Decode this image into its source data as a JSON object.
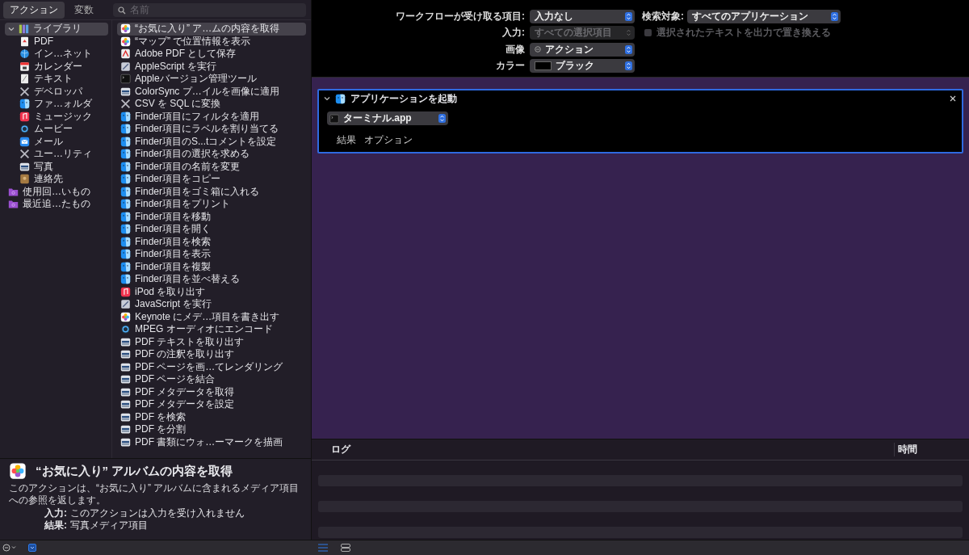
{
  "toolbar": {
    "tabs": [
      {
        "label": "アクション",
        "selected": true
      },
      {
        "label": "変数",
        "selected": false
      }
    ],
    "search": {
      "placeholder": "名前"
    }
  },
  "library": [
    {
      "label": "ライブラリ",
      "kind": "library",
      "selected": true,
      "expanded": true,
      "children": [
        {
          "label": "PDF",
          "kind": "pdf",
          "selected": false
        },
        {
          "label": "イン…ネット",
          "kind": "globe",
          "selected": false
        },
        {
          "label": "カレンダー",
          "kind": "calendar",
          "selected": false
        },
        {
          "label": "テキスト",
          "kind": "text",
          "selected": false
        },
        {
          "label": "デベロッパ",
          "kind": "tools",
          "selected": false
        },
        {
          "label": "ファ…ォルダ",
          "kind": "finder",
          "selected": false
        },
        {
          "label": "ミュージック",
          "kind": "music",
          "selected": false
        },
        {
          "label": "ムービー",
          "kind": "movie",
          "selected": false
        },
        {
          "label": "メール",
          "kind": "mail",
          "selected": false
        },
        {
          "label": "ユー…リティ",
          "kind": "tools",
          "selected": false
        },
        {
          "label": "写真",
          "kind": "image",
          "selected": false
        },
        {
          "label": "連絡先",
          "kind": "contacts",
          "selected": false
        }
      ]
    },
    {
      "label": "使用回…いもの",
      "kind": "folder",
      "selected": false
    },
    {
      "label": "最近追…たもの",
      "kind": "folder",
      "selected": false
    }
  ],
  "actions": [
    {
      "label": "“お気に入り” ア…ムの内容を取得",
      "kind": "photos",
      "selected": true
    },
    {
      "label": "“マップ” で位置情報を表示",
      "kind": "photos",
      "selected": false
    },
    {
      "label": "Adobe PDF として保存",
      "kind": "acrobat",
      "selected": false
    },
    {
      "label": "AppleScript を実行",
      "kind": "script",
      "selected": false
    },
    {
      "label": "Appleバージョン管理ツール",
      "kind": "terminal",
      "selected": false
    },
    {
      "label": "ColorSync プ…イルを画像に適用",
      "kind": "image",
      "selected": false
    },
    {
      "label": "CSV を SQL に変換",
      "kind": "tools",
      "selected": false
    },
    {
      "label": "Finder項目にフィルタを適用",
      "kind": "finder",
      "selected": false
    },
    {
      "label": "Finder項目にラベルを割り当てる",
      "kind": "finder",
      "selected": false
    },
    {
      "label": "Finder項目のS...tコメントを設定",
      "kind": "finder",
      "selected": false
    },
    {
      "label": "Finder項目の選択を求める",
      "kind": "finder",
      "selected": false
    },
    {
      "label": "Finder項目の名前を変更",
      "kind": "finder",
      "selected": false
    },
    {
      "label": "Finder項目をコピー",
      "kind": "finder",
      "selected": false
    },
    {
      "label": "Finder項目をゴミ箱に入れる",
      "kind": "finder",
      "selected": false
    },
    {
      "label": "Finder項目をプリント",
      "kind": "finder",
      "selected": false
    },
    {
      "label": "Finder項目を移動",
      "kind": "finder",
      "selected": false
    },
    {
      "label": "Finder項目を開く",
      "kind": "finder",
      "selected": false
    },
    {
      "label": "Finder項目を検索",
      "kind": "finder",
      "selected": false
    },
    {
      "label": "Finder項目を表示",
      "kind": "finder",
      "selected": false
    },
    {
      "label": "Finder項目を複製",
      "kind": "finder",
      "selected": false
    },
    {
      "label": "Finder項目を並べ替える",
      "kind": "finder",
      "selected": false
    },
    {
      "label": "iPod を取り出す",
      "kind": "music",
      "selected": false
    },
    {
      "label": "JavaScript を実行",
      "kind": "script",
      "selected": false
    },
    {
      "label": "Keynote にメデ…項目を書き出す",
      "kind": "photos",
      "selected": false
    },
    {
      "label": "MPEG オーディオにエンコード",
      "kind": "movie",
      "selected": false
    },
    {
      "label": "PDF テキストを取り出す",
      "kind": "image",
      "selected": false
    },
    {
      "label": "PDF の注釈を取り出す",
      "kind": "image",
      "selected": false
    },
    {
      "label": "PDF ページを画…てレンダリング",
      "kind": "image",
      "selected": false
    },
    {
      "label": "PDF ページを結合",
      "kind": "image",
      "selected": false
    },
    {
      "label": "PDF メタデータを取得",
      "kind": "image",
      "selected": false
    },
    {
      "label": "PDF メタデータを設定",
      "kind": "image",
      "selected": false
    },
    {
      "label": "PDF を検索",
      "kind": "image",
      "selected": false
    },
    {
      "label": "PDF を分割",
      "kind": "image",
      "selected": false
    },
    {
      "label": "PDF 書類にウォ…ーマークを描画",
      "kind": "image",
      "selected": false
    }
  ],
  "description": {
    "title": "“お気に入り” アルバムの内容を取得",
    "body": "このアクションは、“お気に入り” アルバムに含まれるメディア項目への参照を返します。",
    "fields": [
      {
        "label": "入力:",
        "value": "このアクションは入力を受け入れません"
      },
      {
        "label": "結果:",
        "value": "写真メディア項目"
      }
    ]
  },
  "workflow_settings": {
    "receives": {
      "label": "ワークフローが受け取る項目:",
      "value": "入力なし"
    },
    "search_in": {
      "label": "検索対象:",
      "value": "すべてのアプリケーション"
    },
    "input": {
      "label": "入力:",
      "value": "すべての選択項目",
      "disabled": true
    },
    "replace": {
      "label": "選択されたテキストを出力で置き換える",
      "checked": false,
      "disabled": true
    },
    "image": {
      "label": "画像",
      "value": "アクション"
    },
    "color": {
      "label": "カラー",
      "value": "ブラック"
    }
  },
  "workflow": [
    {
      "title": "アプリケーションを起動",
      "expanded": true,
      "selected": true,
      "app": "ターミナル.app",
      "tabs": [
        "結果",
        "オプション"
      ]
    }
  ],
  "log": {
    "columns": [
      "ログ",
      "時間"
    ]
  }
}
